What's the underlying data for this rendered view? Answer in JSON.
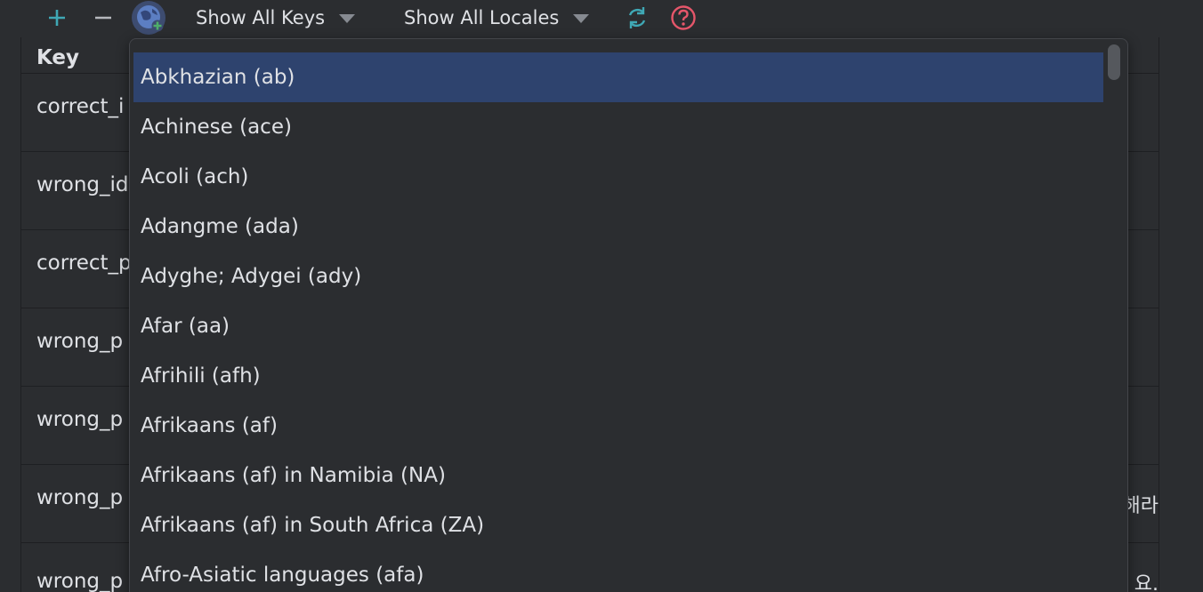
{
  "toolbar": {
    "add_icon": "plus-icon",
    "remove_icon": "minus-icon",
    "globe_icon": "globe-add-icon",
    "keys_filter": "Show All Keys",
    "locales_filter": "Show All Locales",
    "refresh_icon": "refresh-icon",
    "help_icon": "help-icon"
  },
  "table": {
    "key_header": "Key",
    "rows": [
      {
        "key": "correct_i",
        "tail": ""
      },
      {
        "key": "wrong_id",
        "tail": ""
      },
      {
        "key": "correct_p",
        "tail": ""
      },
      {
        "key": "wrong_p",
        "tail": ""
      },
      {
        "key": "wrong_p",
        "tail": ""
      },
      {
        "key": "wrong_p",
        "tail": "해라"
      },
      {
        "key": "wrong_p",
        "tail": "요."
      }
    ]
  },
  "locale_popup": {
    "items": [
      "Abkhazian (ab)",
      "Achinese (ace)",
      "Acoli (ach)",
      "Adangme (ada)",
      "Adyghe; Adygei (ady)",
      "Afar (aa)",
      "Afrihili (afh)",
      "Afrikaans (af)",
      "Afrikaans (af) in Namibia (NA)",
      "Afrikaans (af) in South Africa (ZA)",
      "Afro-Asiatic languages (afa)"
    ],
    "selected_index": 0
  },
  "colors": {
    "background": "#2b2d30",
    "selection": "#2e436e",
    "accent_teal": "#3fa8b5",
    "help_red": "#e5566a",
    "globe_blue": "#5c7ec2"
  }
}
